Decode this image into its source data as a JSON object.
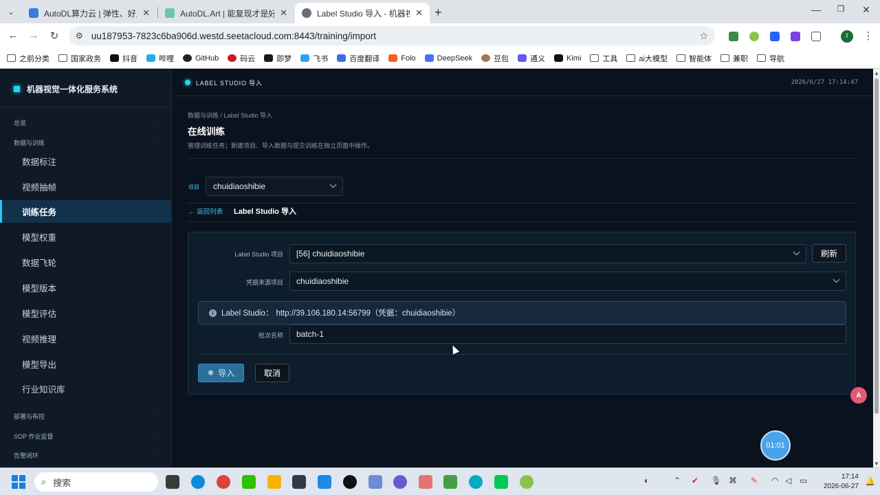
{
  "browser": {
    "tabs": [
      {
        "title": "AutoDL算力云 | 弹性、好用、"
      },
      {
        "title": "AutoDL.Art | 能复现才是好算"
      },
      {
        "title": "Label Studio 导入 - 机器视觉"
      }
    ],
    "url": "uu187953-7823c6ba906d.westd.seetacloud.com:8443/training/import",
    "profile_initial": "I",
    "bookmarks": [
      "之前分类",
      "国家政务",
      "抖音",
      "哔哩",
      "GitHub",
      "码云",
      "即梦",
      "飞书",
      "百度翻译",
      "Folo",
      "DeepSeek",
      "豆包",
      "通义",
      "Kimi",
      "工具",
      "ai大模型",
      "智能体",
      "兼职",
      "导航"
    ]
  },
  "sidebar": {
    "brand": "机器视觉一体化服务系统",
    "sections": {
      "overview": "总览",
      "data_training": "数据与训练",
      "deploy": "部署与布控",
      "sop": "SOP 作业监督",
      "alarm": "告警闭环"
    },
    "items": [
      "数据标注",
      "视频抽帧",
      "训练任务",
      "模型权重",
      "数据飞轮",
      "模型版本",
      "模型评估",
      "视频推理",
      "模型导出",
      "行业知识库"
    ],
    "active_index": 2
  },
  "topbar": {
    "title": "LABEL STUDIO 导入",
    "datetime": "2026/6/27 17:14:47"
  },
  "page": {
    "breadcrumb": "数据与训练 / Label Studio 导入",
    "title": "在线训练",
    "description": "管理训练任务；新建项目、导入数据与提交训练在独立页面中操作。",
    "project_label": "项目",
    "project_value": "chuidiaoshibie",
    "back_link": "← 返回列表",
    "subtitle": "Label Studio 导入"
  },
  "form": {
    "ls_project_label": "Label Studio 项目",
    "ls_project_value": "[56] chuidiaoshibie",
    "refresh_label": "刷新",
    "cred_source_label": "凭据来源项目",
    "cred_source_value": "chuidiaoshibie",
    "alert_prefix": "Label Studio：",
    "alert_value": "http://39.106.180.14:56799（凭据：chuidiaoshibie）",
    "batch_label": "批次名称",
    "batch_value": "batch-1",
    "import_label": "导入",
    "cancel_label": "取消"
  },
  "overlay": {
    "timer": "01:01",
    "translate_glyph": "A"
  },
  "taskbar": {
    "search_placeholder": "搜索",
    "time": "17:14",
    "date": "2026-06-27"
  },
  "colors": {
    "accent": "#2ec5ee",
    "panel_bg": "#0e1d2b",
    "primary_button": "#2a6f9a"
  }
}
